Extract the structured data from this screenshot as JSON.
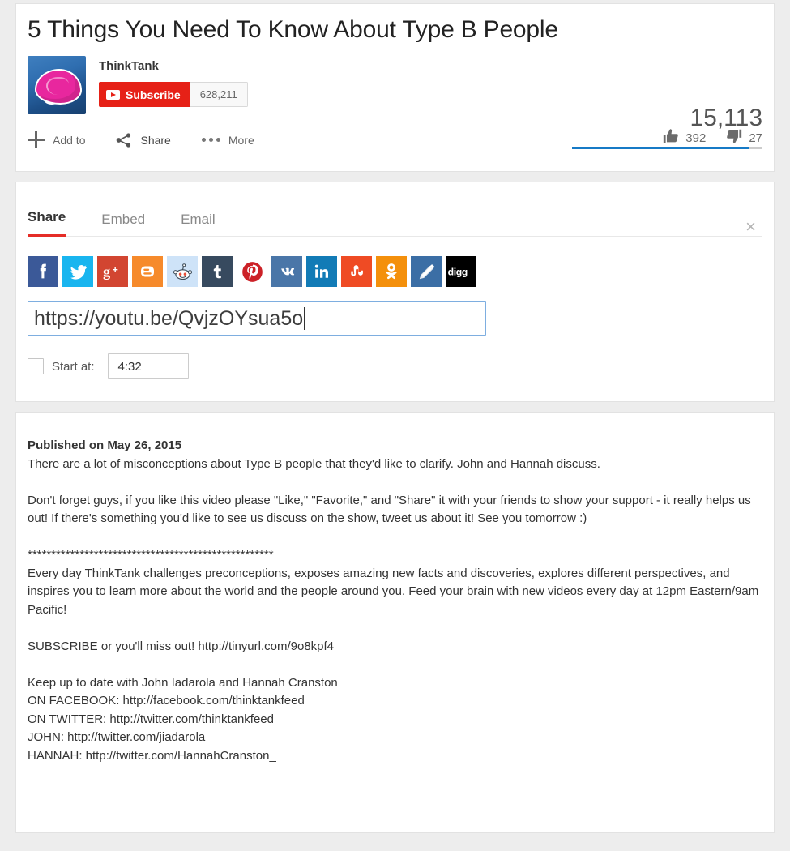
{
  "video": {
    "title": "5 Things You Need To Know About Type B People",
    "channel_name": "ThinkTank",
    "subscribe_label": "Subscribe",
    "subscriber_count": "628,211",
    "view_count": "15,113",
    "likes": "392",
    "dislikes": "27",
    "like_ratio_percent": 93
  },
  "actions": {
    "add_to": "Add to",
    "share": "Share",
    "more": "More"
  },
  "share_panel": {
    "tabs": [
      {
        "label": "Share",
        "active": true
      },
      {
        "label": "Embed",
        "active": false
      },
      {
        "label": "Email",
        "active": false
      }
    ],
    "close_label": "×",
    "url_value": "https://youtu.be/QvjzOYsua5o",
    "url_placeholder": "https://youtu.be/",
    "start_at_label": "Start at:",
    "start_at_value": "4:32",
    "start_at_checked": false,
    "social_buttons": [
      {
        "name": "facebook",
        "label": "Facebook",
        "color": "#3b5998"
      },
      {
        "name": "twitter",
        "label": "Twitter",
        "color": "#19b5ef"
      },
      {
        "name": "google-plus",
        "label": "Google+",
        "color": "#d24531"
      },
      {
        "name": "blogger",
        "label": "Blogger",
        "color": "#f68a2b"
      },
      {
        "name": "reddit",
        "label": "reddit",
        "color": "#cee3f8"
      },
      {
        "name": "tumblr",
        "label": "Tumblr",
        "color": "#374a5f"
      },
      {
        "name": "pinterest",
        "label": "Pinterest",
        "color": "#ffffff"
      },
      {
        "name": "vk",
        "label": "VK",
        "color": "#4a76a8"
      },
      {
        "name": "linkedin",
        "label": "LinkedIn",
        "color": "#127bb6"
      },
      {
        "name": "stumbleupon",
        "label": "StumbleUpon",
        "color": "#ef4b24"
      },
      {
        "name": "odnoklassniki",
        "label": "Odnoklassniki",
        "color": "#f4900c"
      },
      {
        "name": "livejournal",
        "label": "LiveJournal",
        "color": "#3b6ea5"
      },
      {
        "name": "digg",
        "label": "digg",
        "color": "#000000"
      }
    ]
  },
  "description": {
    "published": "Published on May 26, 2015",
    "para1": "There are a lot of misconceptions about Type B people that they'd like to clarify. John and Hannah discuss.",
    "para2": "Don't forget guys, if you like this video please \"Like,\" \"Favorite,\" and \"Share\" it with your friends to show your support - it really helps us out! If there's something you'd like to see us discuss on the show, tweet us about it! See you tomorrow :)",
    "stars": "****************************************************",
    "para3": "Every day ThinkTank challenges preconceptions, exposes amazing new facts and discoveries, explores different perspectives, and inspires you to learn more about the world and the people around you. Feed your brain with new videos every day at 12pm Eastern/9am Pacific!",
    "para4": "SUBSCRIBE or you'll miss out! http://tinyurl.com/9o8kpf4",
    "line_keepup": "Keep up to date with John Iadarola and Hannah Cranston",
    "line_facebook": "ON FACEBOOK: http://facebook.com/thinktankfeed",
    "line_twitter": "ON TWITTER: http://twitter.com/thinktankfeed",
    "line_john": "JOHN: http://twitter.com/jiadarola",
    "line_hannah": "HANNAH: http://twitter.com/HannahCranston_"
  }
}
